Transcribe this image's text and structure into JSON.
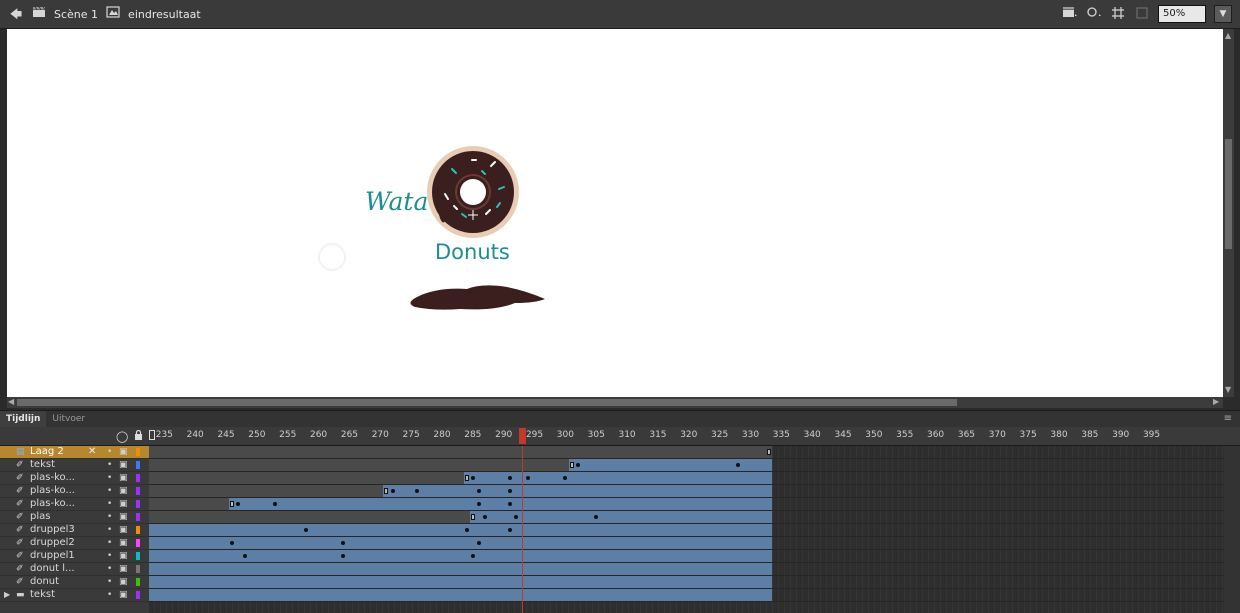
{
  "edit_bar": {
    "scene_label": "Scène 1",
    "symbol_label": "eindresultaat",
    "zoom_value": "50%"
  },
  "stage": {
    "logo_text_top": "Wata",
    "logo_text_bottom": "Donuts",
    "brand_text_color": "#1b8f8b",
    "donut_icing_color": "#3b1f1e"
  },
  "timeline": {
    "tabs": [
      "Tijdlijn",
      "Uitvoer"
    ],
    "active_tab": "Tijdlijn",
    "ruler_labels": [
      "235",
      "240",
      "245",
      "250",
      "255",
      "260",
      "265",
      "270",
      "275",
      "280",
      "285",
      "290",
      "295",
      "300",
      "305",
      "310",
      "315",
      "320",
      "325",
      "330",
      "335",
      "340",
      "345",
      "350",
      "355",
      "360",
      "365",
      "370",
      "375",
      "380",
      "385",
      "390",
      "395"
    ],
    "ruler_start_frame": 233,
    "current_frame": 293,
    "layers": [
      {
        "name": "Laag 2",
        "type": "layer",
        "selected": true,
        "color": "#f28c00"
      },
      {
        "name": "tekst",
        "type": "motion",
        "color": "#3b79ff"
      },
      {
        "name": "plas-ko...",
        "type": "motion",
        "color": "#9b30ff"
      },
      {
        "name": "plas-ko...",
        "type": "motion",
        "color": "#9b30ff"
      },
      {
        "name": "plas-ko...",
        "type": "motion",
        "color": "#9b30ff"
      },
      {
        "name": "plas",
        "type": "motion",
        "color": "#9b30ff"
      },
      {
        "name": "druppel3",
        "type": "motion",
        "color": "#f28c00"
      },
      {
        "name": "druppel2",
        "type": "motion",
        "color": "#ff40ff"
      },
      {
        "name": "druppel1",
        "type": "motion",
        "color": "#00c0c0"
      },
      {
        "name": "donut l...",
        "type": "motion",
        "color": "#777777"
      },
      {
        "name": "donut",
        "type": "motion",
        "color": "#40c000"
      },
      {
        "name": "tekst",
        "type": "folder",
        "color": "#9b30ff"
      }
    ],
    "frame_rows": [
      {
        "segments": [
          {
            "kind": "static",
            "from": 233,
            "to": 334
          }
        ],
        "keyframes": [],
        "empty_keys": [
          333
        ]
      },
      {
        "segments": [
          {
            "kind": "static",
            "from": 233,
            "to": 301
          },
          {
            "kind": "tween",
            "from": 301,
            "to": 334
          }
        ],
        "keyframes": [
          302,
          328
        ],
        "empty_keys": [
          301
        ]
      },
      {
        "segments": [
          {
            "kind": "static",
            "from": 233,
            "to": 284
          },
          {
            "kind": "tween",
            "from": 284,
            "to": 334
          }
        ],
        "keyframes": [
          285,
          291,
          294,
          300
        ],
        "empty_keys": [
          284
        ]
      },
      {
        "segments": [
          {
            "kind": "static",
            "from": 233,
            "to": 271
          },
          {
            "kind": "tween",
            "from": 271,
            "to": 334
          }
        ],
        "keyframes": [
          272,
          276,
          286,
          291
        ],
        "empty_keys": [
          271
        ]
      },
      {
        "segments": [
          {
            "kind": "static",
            "from": 233,
            "to": 246
          },
          {
            "kind": "tween",
            "from": 246,
            "to": 334
          }
        ],
        "keyframes": [
          247,
          253,
          286,
          291
        ],
        "empty_keys": [
          246
        ]
      },
      {
        "segments": [
          {
            "kind": "static",
            "from": 233,
            "to": 285
          },
          {
            "kind": "tween",
            "from": 285,
            "to": 334
          }
        ],
        "keyframes": [
          287,
          292,
          305
        ],
        "empty_keys": [
          285
        ]
      },
      {
        "segments": [
          {
            "kind": "tween",
            "from": 233,
            "to": 334
          }
        ],
        "keyframes": [
          258,
          284,
          291
        ],
        "empty_keys": []
      },
      {
        "segments": [
          {
            "kind": "tween",
            "from": 233,
            "to": 334
          }
        ],
        "keyframes": [
          246,
          264,
          286
        ],
        "empty_keys": []
      },
      {
        "segments": [
          {
            "kind": "tween",
            "from": 233,
            "to": 334
          }
        ],
        "keyframes": [
          248,
          264,
          285
        ],
        "empty_keys": []
      },
      {
        "segments": [
          {
            "kind": "tween",
            "from": 233,
            "to": 334
          }
        ],
        "keyframes": [],
        "empty_keys": []
      },
      {
        "segments": [
          {
            "kind": "tween",
            "from": 233,
            "to": 334
          }
        ],
        "keyframes": [],
        "empty_keys": []
      },
      {
        "segments": [
          {
            "kind": "tween",
            "from": 233,
            "to": 334
          }
        ],
        "keyframes": [],
        "empty_keys": []
      }
    ]
  }
}
